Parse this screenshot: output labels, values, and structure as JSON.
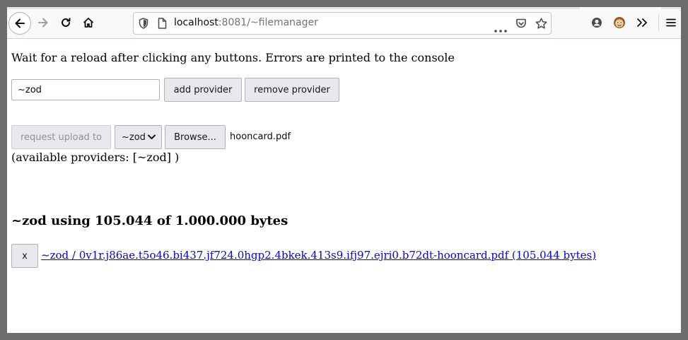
{
  "browser": {
    "url_host": "localhost",
    "url_path": ":8081/~filemanager"
  },
  "page": {
    "instructions": "Wait for a reload after clicking any buttons. Errors are printed to the console",
    "provider_input_value": "~zod",
    "add_provider_label": "add provider",
    "remove_provider_label": "remove provider",
    "request_upload_label": "request upload to",
    "provider_select_value": "~zod",
    "browse_label": "Browse...",
    "selected_file": "hooncard.pdf",
    "available_providers": "(available providers: [~zod] )",
    "usage_heading": "~zod using 105.044 of 1.000.000 bytes",
    "files": [
      {
        "delete_label": "x",
        "link_text": "~zod / 0v1r.j86ae.t5o46.bi437.jf724.0hgp2.4bkek.413s9.ifj97.ejri0.b72dt-hooncard.pdf (105.044 bytes)"
      }
    ]
  },
  "colors": {
    "link": "#0000ee",
    "toolbar_bg": "#f9f9fa",
    "outer_frame": "#6d6d6d"
  },
  "icons": [
    "back-arrow-icon",
    "forward-arrow-icon",
    "reload-icon",
    "home-icon",
    "shield-icon",
    "page-icon",
    "more-dots-icon",
    "pocket-icon",
    "bookmark-star-icon",
    "account-icon",
    "extension-monkey-icon",
    "overflow-chevrons-icon",
    "hamburger-menu-icon",
    "dropdown-chevron-icon"
  ]
}
